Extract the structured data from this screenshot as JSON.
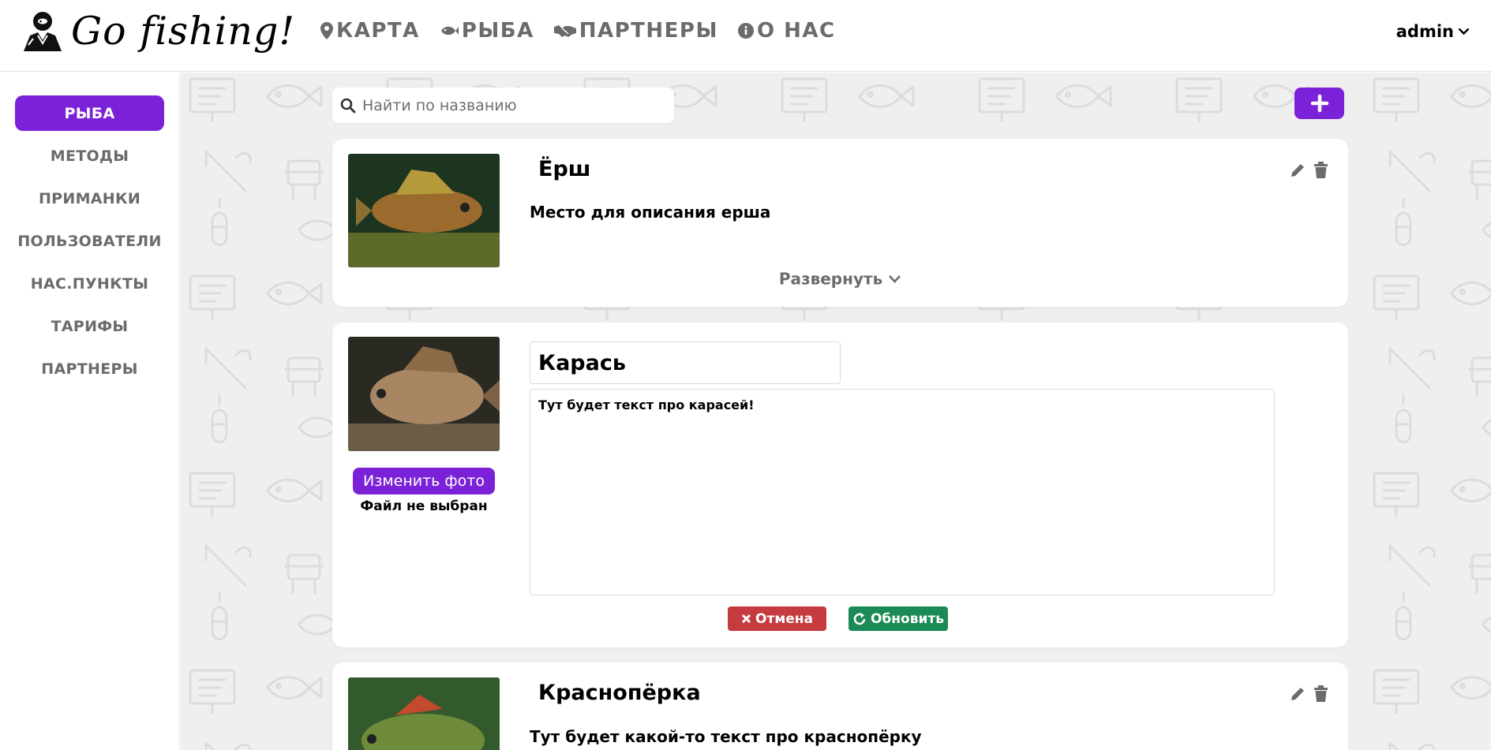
{
  "header": {
    "logo_text": "Go fishing!",
    "nav": [
      {
        "label": "КАРТА",
        "icon": "map-pin-icon"
      },
      {
        "label": "РЫБА",
        "icon": "fish-icon"
      },
      {
        "label": "ПАРТНЕРЫ",
        "icon": "handshake-icon"
      },
      {
        "label": "О НАС",
        "icon": "info-icon"
      }
    ],
    "user": "admin"
  },
  "sidebar": {
    "items": [
      {
        "label": "РЫБА",
        "active": true
      },
      {
        "label": "МЕТОДЫ"
      },
      {
        "label": "ПРИМАНКИ"
      },
      {
        "label": "ПОЛЬЗОВАТЕЛИ"
      },
      {
        "label": "НАС.ПУНКТЫ"
      },
      {
        "label": "ТАРИФЫ"
      },
      {
        "label": "ПАРТНЕРЫ"
      }
    ]
  },
  "search": {
    "placeholder": "Найти по названию",
    "value": ""
  },
  "fish_list": [
    {
      "name": "Ёрш",
      "description": "Место для описания ерша",
      "expand_label": "Развернуть",
      "mode": "view"
    },
    {
      "name": "Карась",
      "description": "Тут будет текст про карасей!",
      "mode": "edit",
      "change_photo_label": "Изменить фото",
      "file_status": "Файл не выбран",
      "cancel_label": "Отмена",
      "update_label": "Обновить"
    },
    {
      "name": "Краснопёрка",
      "description": "Тут будет какой-то текст про краснопёрку",
      "mode": "view"
    }
  ],
  "colors": {
    "accent": "#7b22d8",
    "nav_text": "#6b6b6b",
    "cancel": "#c63b3f",
    "update": "#1b8a56",
    "background": "#efefef"
  }
}
